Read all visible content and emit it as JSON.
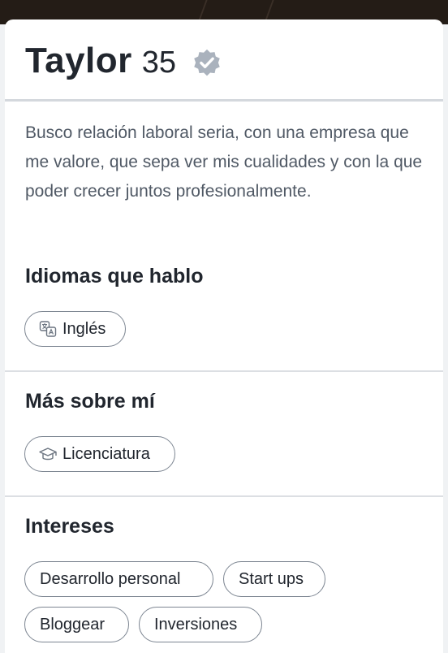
{
  "profile": {
    "name": "Taylor",
    "age": "35",
    "bio": "Busco relación laboral seria, con una empresa que me valore, que sepa ver mis cualidades y con la que poder crecer juntos profesionalmente."
  },
  "sections": {
    "languages": {
      "title": "Idiomas que hablo",
      "items": [
        {
          "label": "Inglés",
          "icon": "translate-icon"
        }
      ]
    },
    "about": {
      "title": "Más sobre mí",
      "items": [
        {
          "label": "Licenciatura",
          "icon": "graduation-cap-icon"
        }
      ]
    },
    "interests": {
      "title": "Intereses",
      "items": [
        {
          "label": "Desarrollo personal"
        },
        {
          "label": "Start ups"
        },
        {
          "label": "Bloggear"
        },
        {
          "label": "Inversiones"
        }
      ]
    }
  },
  "colors": {
    "text_primary": "#21262e",
    "text_secondary": "#505965",
    "verified_badge": "#aab2bd",
    "chip_border": "#7c8591"
  }
}
